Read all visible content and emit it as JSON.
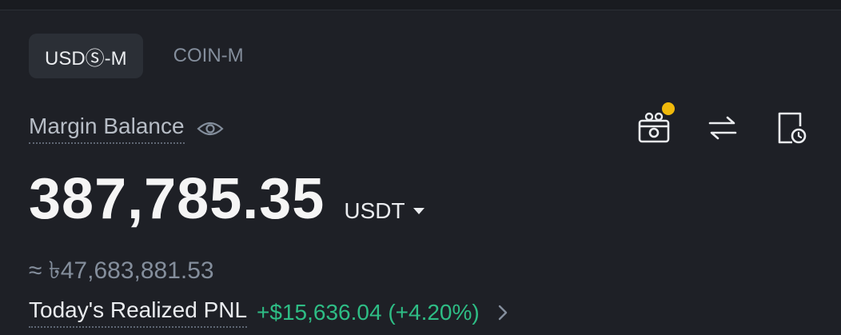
{
  "tabs": [
    {
      "label": "USDⓈ-M",
      "active": true
    },
    {
      "label": "COIN-M",
      "active": false
    }
  ],
  "margin": {
    "label": "Margin Balance",
    "value": "387,785.35",
    "unit": "USDT",
    "approx": "≈ ৳47,683,881.53"
  },
  "pnl": {
    "label": "Today's Realized PNL",
    "value": "+$15,636.04 (+4.20%)"
  },
  "icons": {
    "visibility": "eye-icon",
    "rewards": "gift-camera-icon",
    "transfer": "transfer-arrows-icon",
    "history": "document-clock-icon",
    "details": "chevron-right-icon"
  },
  "colors": {
    "background": "#1e2026",
    "positive": "#2ebd85",
    "notification": "#f0b90b"
  }
}
